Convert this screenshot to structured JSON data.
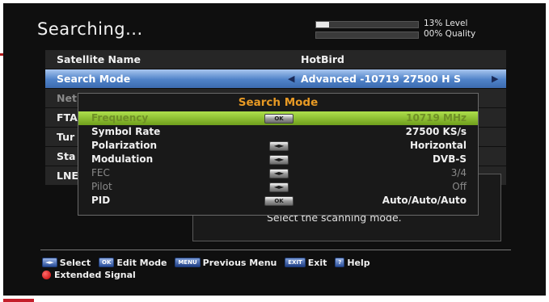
{
  "screen": {
    "title": "Searching...",
    "signal": {
      "level_percent": 13,
      "level_text": "13% Level",
      "quality_percent": 0,
      "quality_text": "00% Quality"
    }
  },
  "main_menu": {
    "items": [
      {
        "label": "Satellite Name",
        "value": "HotBird"
      },
      {
        "label": "Search Mode",
        "value": "Advanced -10719 27500 H S",
        "selected": true
      },
      {
        "label": "Net",
        "value": ""
      },
      {
        "label": "FTA",
        "value": ""
      },
      {
        "label": "Tur",
        "value": ""
      },
      {
        "label": "Sta",
        "value": ""
      },
      {
        "label": "LNE",
        "value": ""
      }
    ]
  },
  "popup": {
    "title": "Search Mode",
    "rows": [
      {
        "label": "Frequency",
        "key": "OK",
        "value": "10719 MHz",
        "highlighted": true
      },
      {
        "label": "Symbol Rate",
        "key": "",
        "value": "27500 KS/s"
      },
      {
        "label": "Polarization",
        "key": "◄►",
        "value": "Horizontal"
      },
      {
        "label": "Modulation",
        "key": "◄►",
        "value": "DVB-S"
      },
      {
        "label": "FEC",
        "key": "◄►",
        "value": "3/4",
        "disabled": true
      },
      {
        "label": "Pilot",
        "key": "◄►",
        "value": "Off",
        "disabled": true
      },
      {
        "label": "PID",
        "key": "OK",
        "value": "Auto/Auto/Auto"
      }
    ]
  },
  "help_text": "Select the scanning mode.",
  "footer": {
    "select_key": "◄►",
    "select": "Select",
    "edit_key": "OK",
    "edit": "Edit Mode",
    "menu_key": "MENU",
    "previous": "Previous Menu",
    "exit_key": "EXIT",
    "exit": "Exit",
    "help_key": "?",
    "help": "Help",
    "extended": "Extended Signal"
  },
  "colors": {
    "accent_title": "#e89a24",
    "selected_row": "#4f82c8",
    "highlight_row": "#8cc43a"
  }
}
